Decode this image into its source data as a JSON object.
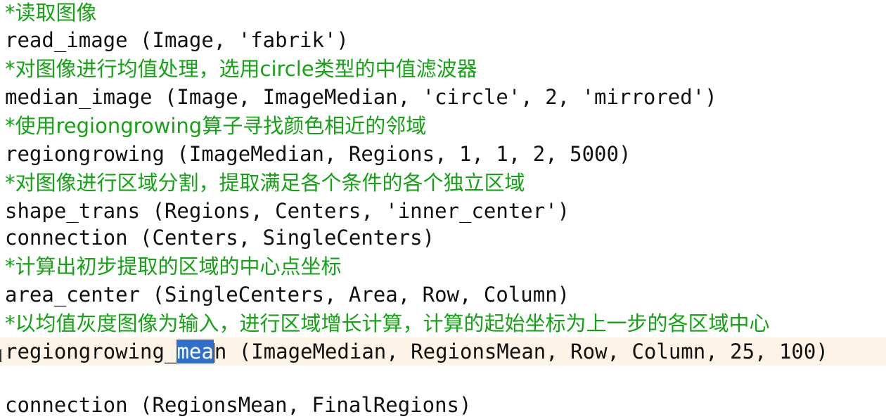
{
  "lines": [
    {
      "type": "comment",
      "text": "*读取图像"
    },
    {
      "type": "code",
      "text": "read_image (Image, 'fabrik')"
    },
    {
      "type": "comment",
      "text": "*对图像进行均值处理，选用circle类型的中值滤波器"
    },
    {
      "type": "code",
      "text": "median_image (Image, ImageMedian, 'circle', 2, 'mirrored')"
    },
    {
      "type": "comment",
      "text": "*使用regiongrowing算子寻找颜色相近的邻域"
    },
    {
      "type": "code",
      "text": "regiongrowing (ImageMedian, Regions, 1, 1, 2, 5000)"
    },
    {
      "type": "comment",
      "text": "*对图像进行区域分割，提取满足各个条件的各个独立区域"
    },
    {
      "type": "code",
      "text": "shape_trans (Regions, Centers, 'inner_center')"
    },
    {
      "type": "code",
      "text": "connection (Centers, SingleCenters)"
    },
    {
      "type": "comment",
      "text": "*计算出初步提取的区域的中心点坐标"
    },
    {
      "type": "code",
      "text": "area_center (SingleCenters, Area, Row, Column)"
    },
    {
      "type": "comment",
      "text": "*以均值灰度图像为输入，进行区域增长计算，计算的起始坐标为上一步的各区域中心"
    },
    {
      "type": "code_current",
      "before": "regiongrowing_",
      "selected": "mea",
      "after": "n (ImageMedian, RegionsMean, Row, Column, 25, 100)"
    },
    {
      "type": "empty",
      "text": ""
    },
    {
      "type": "code",
      "text": "connection (RegionsMean, FinalRegions)"
    }
  ],
  "colors": {
    "comment": "#15a315",
    "code": "#111111",
    "selection": "#2f6fc9",
    "current_line": "#fdf3e7"
  }
}
